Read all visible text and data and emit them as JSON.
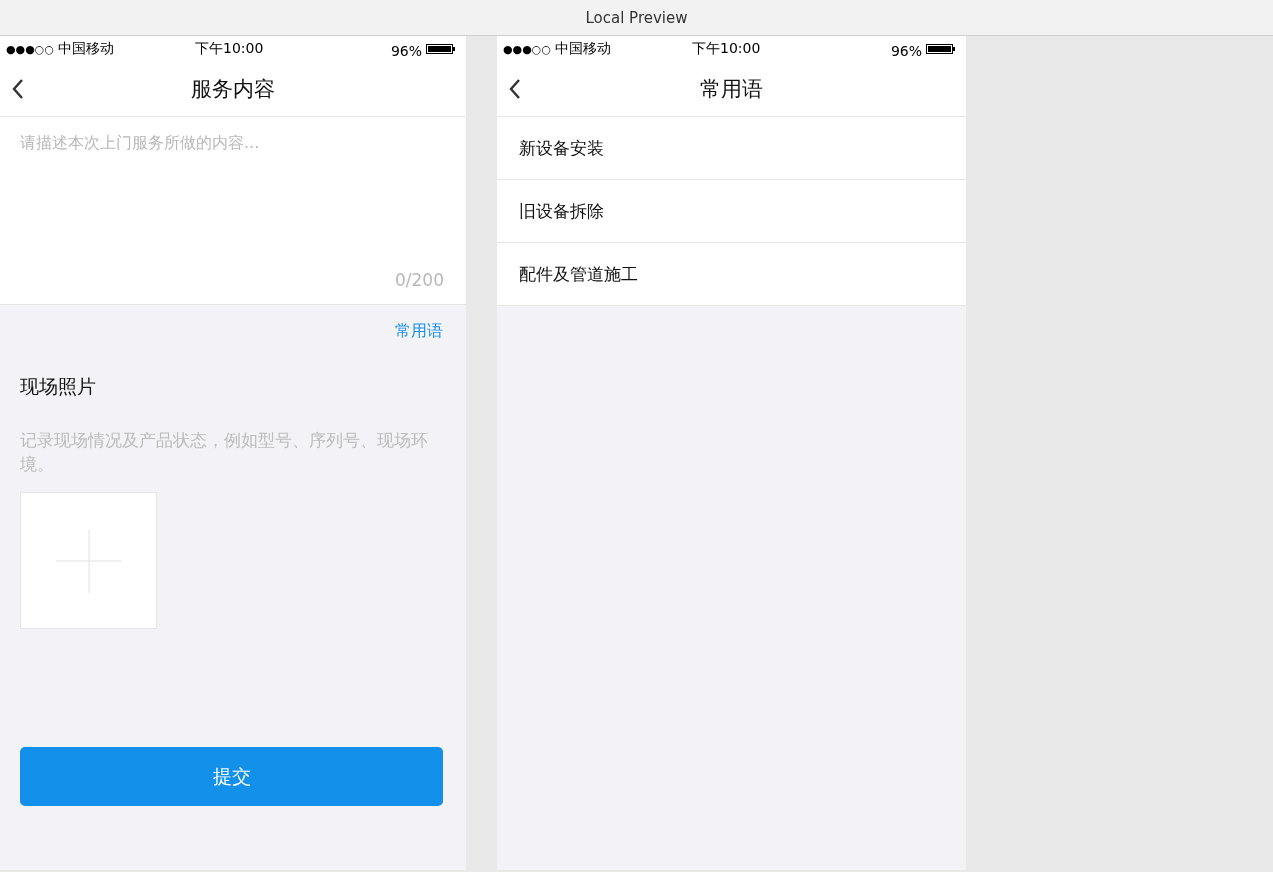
{
  "window": {
    "title": "Local Preview"
  },
  "screens": [
    {
      "kind": "form",
      "status_bar": {
        "signal": "●●●○○",
        "carrier": "中国移动",
        "time": "下午10:00",
        "battery": "96%"
      },
      "title": "服务内容",
      "textarea": {
        "placeholder": "请描述本次上门服务所做的内容...",
        "counter": "0/200"
      },
      "phrases_link": "常用语",
      "photos": {
        "heading": "现场照片",
        "hint": "记录现场情况及产品状态，例如型号、序列号、现场环境。"
      },
      "submit": "提交"
    },
    {
      "kind": "list",
      "status_bar": {
        "signal": "●●●○○",
        "carrier": "中国移动",
        "time": "下午10:00",
        "battery": "96%"
      },
      "title": "常用语",
      "items": [
        "新设备安装",
        "旧设备拆除",
        "配件及管道施工"
      ]
    }
  ]
}
